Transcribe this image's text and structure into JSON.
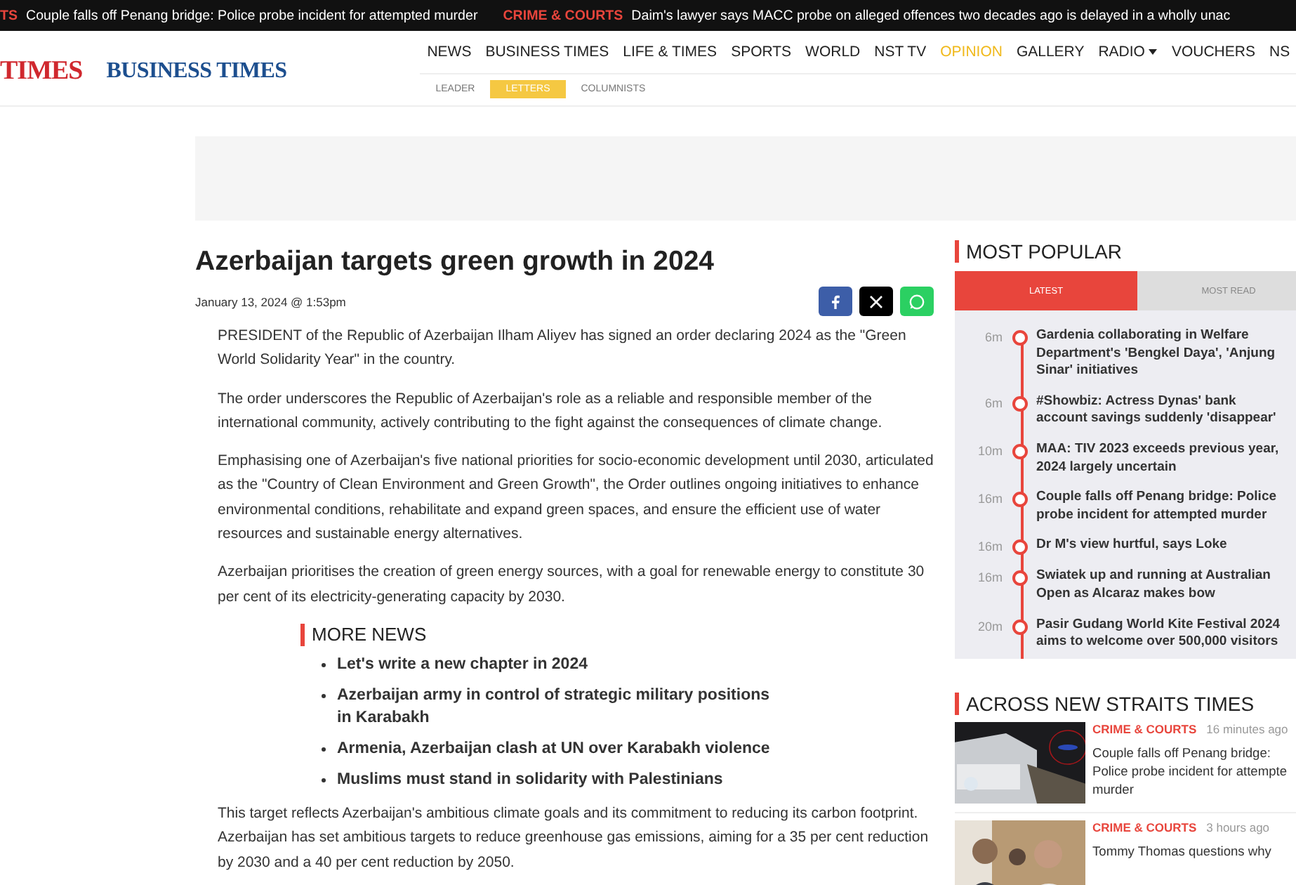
{
  "ticker": {
    "items": [
      {
        "label": "TS",
        "headline": "Couple falls off Penang bridge: Police probe incident for attempted murder"
      },
      {
        "label": "CRIME & COURTS",
        "headline": "Daim's lawyer says MACC probe on alleged offences two decades ago is delayed in a wholly unac"
      }
    ]
  },
  "header": {
    "logo": "TIMES",
    "logo_2": "BUSINESS TIMES",
    "nav": [
      {
        "label": "NEWS",
        "selected": false
      },
      {
        "label": "BUSINESS TIMES",
        "selected": false
      },
      {
        "label": "LIFE & TIMES",
        "selected": false
      },
      {
        "label": "SPORTS",
        "selected": false
      },
      {
        "label": "WORLD",
        "selected": false
      },
      {
        "label": "NST TV",
        "selected": false
      },
      {
        "label": "OPINION",
        "selected": true
      },
      {
        "label": "GALLERY",
        "selected": false
      },
      {
        "label": "RADIO",
        "selected": false,
        "dropdown": true
      },
      {
        "label": "VOUCHERS",
        "selected": false
      },
      {
        "label": "NS",
        "selected": false
      }
    ],
    "subnav": [
      {
        "label": "LEADER",
        "selected": false
      },
      {
        "label": "LETTERS",
        "selected": true
      },
      {
        "label": "COLUMNISTS",
        "selected": false
      }
    ]
  },
  "article": {
    "title": "Azerbaijan targets green growth in 2024",
    "date": "January 13, 2024 @ 1:53pm",
    "share": [
      {
        "kind": "facebook"
      },
      {
        "kind": "x"
      },
      {
        "kind": "whatsapp"
      }
    ],
    "paragraphs_before": [
      "PRESIDENT of the Republic of Azerbaijan Ilham Aliyev has signed an order declaring 2024 as the \"Green World Solidarity Year\" in the country.",
      "The order underscores the Republic of Azerbaijan's role as a reliable and responsible member of the international community, actively contributing to the fight against the consequences of climate change.",
      "Emphasising one of Azerbaijan's five national priorities for socio-economic development until 2030, articulated as the \"Country of Clean Environment and Green Growth\", the Order outlines ongoing initiatives to enhance environmental conditions, rehabilitate and expand green spaces, and ensure the efficient use of water resources and sustainable energy alternatives.",
      "Azerbaijan prioritises the creation of green energy sources, with a goal for renewable energy to constitute 30 per cent of its electricity-generating capacity by 2030."
    ],
    "more_news": {
      "title": "MORE NEWS",
      "items": [
        "Let's write a new chapter in 2024",
        "Azerbaijan army in control of strategic military positions in Karabakh",
        "Armenia, Azerbaijan clash at UN over Karabakh violence",
        "Muslims must stand in solidarity with Palestinians"
      ]
    },
    "paragraphs_after": [
      "This target reflects Azerbaijan's ambitious climate goals and its commitment to reducing its carbon footprint. Azerbaijan has set ambitious targets to reduce greenhouse gas emissions, aiming for a 35 per cent reduction by 2030 and a 40 per cent reduction by 2050."
    ]
  },
  "most_popular": {
    "title": "MOST POPULAR",
    "tabs": [
      {
        "label": "LATEST",
        "selected": true
      },
      {
        "label": "MOST READ",
        "selected": false
      }
    ],
    "items": [
      {
        "time": "6m",
        "title": "Gardenia collaborating in Welfare Department's 'Bengkel Daya', 'Anjung Sinar' initiatives"
      },
      {
        "time": "6m",
        "title": "#Showbiz: Actress Dynas' bank account savings suddenly 'disappear'"
      },
      {
        "time": "10m",
        "title": "MAA: TIV 2023 exceeds previous year, 2024 largely uncertain"
      },
      {
        "time": "16m",
        "title": "Couple falls off Penang bridge: Police probe incident for attempted murder"
      },
      {
        "time": "16m",
        "title": "Dr M's view hurtful, says Loke"
      },
      {
        "time": "16m",
        "title": "Swiatek up and running at Australian Open as Alcaraz makes bow"
      },
      {
        "time": "20m",
        "title": "Pasir Gudang World Kite Festival 2024 aims to welcome over 500,000 visitors"
      }
    ]
  },
  "across": {
    "title": "ACROSS NEW STRAITS TIMES",
    "items": [
      {
        "category": "CRIME & COURTS",
        "time": "16 minutes ago",
        "title": "Couple falls off Penang bridge:\nPolice probe incident for attempte\nmurder"
      },
      {
        "category": "CRIME & COURTS",
        "time": "3 hours ago",
        "title": "Tommy Thomas questions why"
      }
    ]
  }
}
